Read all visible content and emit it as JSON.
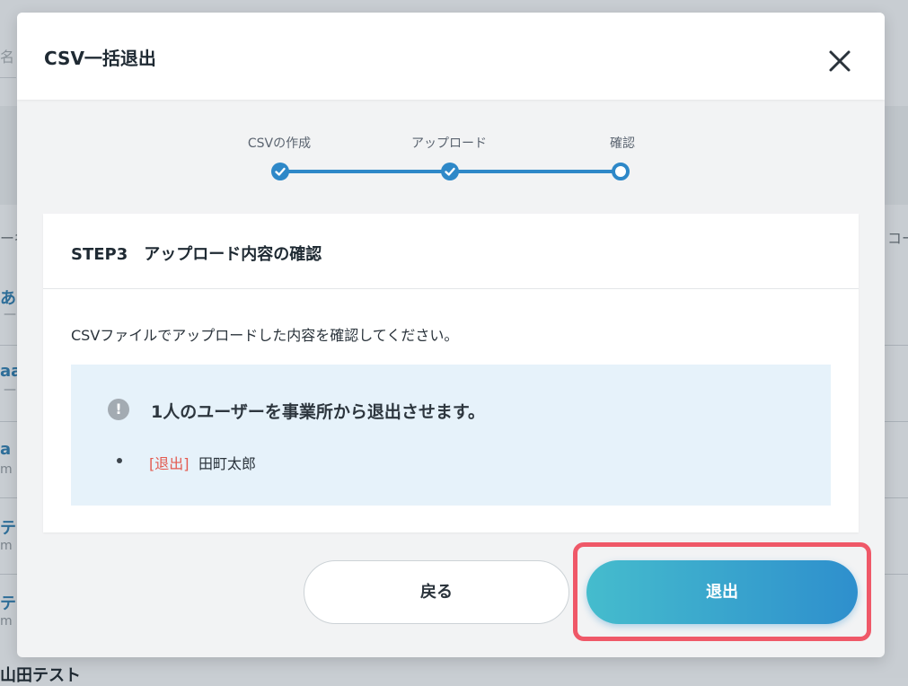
{
  "background": {
    "name_header_fragment": "名",
    "left_column_fragment": "ー名",
    "right_column_fragment": "コー",
    "rows": [
      {
        "text": "あ",
        "sub": "—"
      },
      {
        "text": "aa",
        "sub": "—"
      },
      {
        "text": "a",
        "sub": "m"
      },
      {
        "text": "テ",
        "sub": "m"
      },
      {
        "text": "テ",
        "sub": "m"
      }
    ],
    "bottom_row": "山田テスト"
  },
  "modal": {
    "title": "CSV一括退出",
    "close_icon": "close-icon"
  },
  "stepper": {
    "steps": [
      {
        "label": "CSVの作成",
        "status": "done"
      },
      {
        "label": "アップロード",
        "status": "done"
      },
      {
        "label": "確認",
        "status": "current"
      }
    ],
    "accent_color": "#2e88c8"
  },
  "card": {
    "title": "STEP3　アップロード内容の確認",
    "description": "CSVファイルでアップロードした内容を確認してください。",
    "info": {
      "icon": "exclamation-icon",
      "message": "1人のユーザーを事業所から退出させます。",
      "items": [
        {
          "tag": "[退出]",
          "name": "田町太郎"
        }
      ]
    }
  },
  "buttons": {
    "back_label": "戻る",
    "exit_label": "退出",
    "highlight_color": "#ef5868"
  }
}
